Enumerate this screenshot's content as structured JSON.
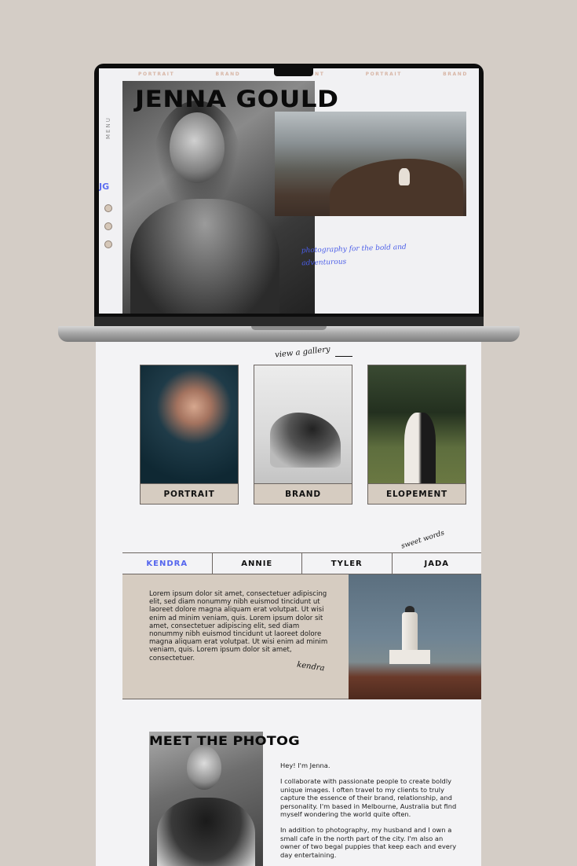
{
  "laptop_site": {
    "nav": [
      "PORTRAIT",
      "BRAND",
      "ELOPEMENT",
      "PORTRAIT",
      "BRAND"
    ],
    "title": "JENNA GOULD",
    "side_menu": "MENU",
    "side_logo": "JG",
    "tagline": "photography for the bold and adventurous"
  },
  "gallery": {
    "label": "view a gallery",
    "cards": [
      {
        "label": "PORTRAIT"
      },
      {
        "label": "BRAND"
      },
      {
        "label": "ELOPEMENT"
      }
    ]
  },
  "testimonials": {
    "label": "sweet words",
    "tabs": [
      "KENDRA",
      "ANNIE",
      "TYLER",
      "JADA"
    ],
    "active_tab": "KENDRA",
    "text": "Lorem ipsum dolor sit amet, consectetuer adipiscing elit, sed diam nonummy nibh euismod tincidunt ut laoreet dolore magna aliquam erat volutpat. Ut wisi enim ad minim veniam, quis. Lorem ipsum dolor sit amet, consectetuer adipiscing elit, sed diam nonummy nibh euismod tincidunt ut laoreet dolore magna aliquam erat volutpat. Ut wisi enim ad minim veniam, quis. Lorem ipsum dolor sit amet, consectetuer.",
    "signature": "kendra"
  },
  "about": {
    "title": "MEET THE PHOTOG",
    "greeting": "Hey! I'm Jenna.",
    "para1": "I collaborate with passionate people to create boldly unique images. I often travel to my clients to truly capture the essence of their brand, relationship, and personality. I'm based in Melbourne, Australia but find myself wondering the world quite often.",
    "para2": "In addition to photography, my husband and I own a small cafe in the north part of the city. I'm also an owner of two begal puppies that keep each and every day entertaining."
  },
  "colors": {
    "background": "#d4cdc6",
    "accent": "#5566ee",
    "panel": "#d6ccc1"
  }
}
